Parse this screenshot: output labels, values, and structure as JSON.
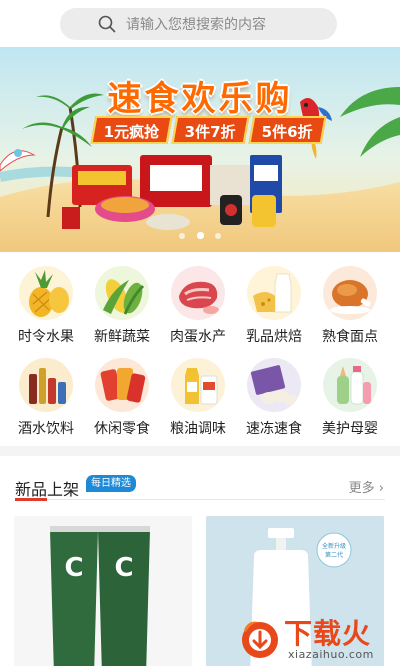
{
  "search": {
    "placeholder": "请输入您想搜索的内容"
  },
  "banner": {
    "title": "速食欢乐购",
    "promos": [
      "1元疯抢",
      "3件7折",
      "5件6折"
    ],
    "slide_count": 3,
    "active_slide": 1
  },
  "categories": [
    {
      "label": "时令水果",
      "icon": "pineapple-icon"
    },
    {
      "label": "新鲜蔬菜",
      "icon": "corn-icon"
    },
    {
      "label": "肉蛋水产",
      "icon": "meat-icon"
    },
    {
      "label": "乳品烘焙",
      "icon": "milk-icon"
    },
    {
      "label": "熟食面点",
      "icon": "roast-chicken-icon"
    },
    {
      "label": "酒水饮料",
      "icon": "drinks-icon"
    },
    {
      "label": "休闲零食",
      "icon": "snacks-icon"
    },
    {
      "label": "粮油调味",
      "icon": "oil-icon"
    },
    {
      "label": "速冻速食",
      "icon": "frozen-food-icon"
    },
    {
      "label": "美护母婴",
      "icon": "baby-bottle-icon"
    }
  ],
  "section": {
    "title": "新品上架",
    "badge": "每日精选",
    "more": "更多 ›"
  },
  "products": [
    {
      "brand_text": "C"
    },
    {
      "brand_text": "全新升级 第二代"
    }
  ],
  "watermark": {
    "text": "下载火",
    "url": "xiazaihuo.com"
  },
  "colors": {
    "accent": "#e03a2d",
    "badge": "#1e8ad6",
    "banner_title": "#ff6a00"
  }
}
